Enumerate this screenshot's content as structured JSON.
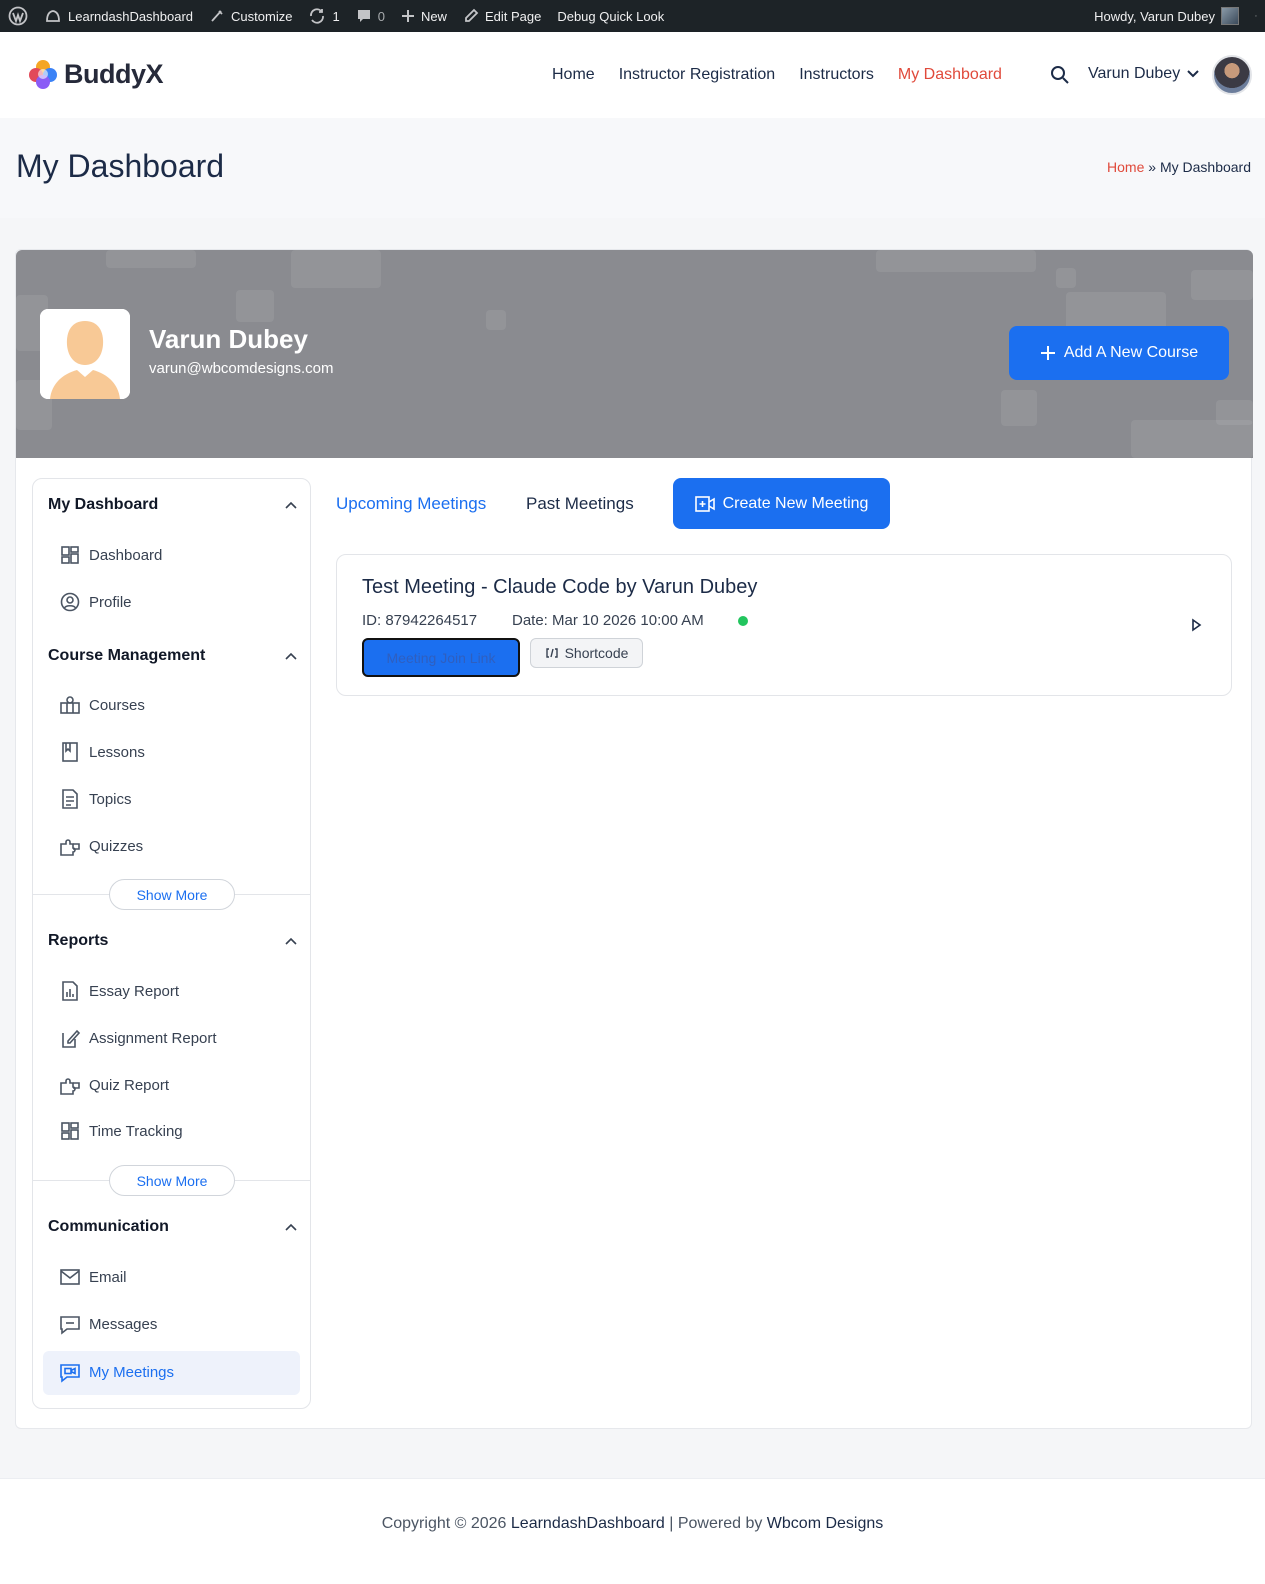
{
  "admin_bar": {
    "site_name": "LearndashDashboard",
    "customize": "Customize",
    "updates_count": "1",
    "comments_count": "0",
    "new_label": "New",
    "edit_page": "Edit Page",
    "debug": "Debug Quick Look",
    "howdy": "Howdy, Varun Dubey"
  },
  "header": {
    "logo_text": "BuddyX",
    "nav": [
      {
        "label": "Home"
      },
      {
        "label": "Instructor Registration"
      },
      {
        "label": "Instructors"
      },
      {
        "label": "My Dashboard",
        "active": true
      }
    ],
    "user_name": "Varun Dubey"
  },
  "page": {
    "title": "My Dashboard",
    "breadcrumb_home": "Home",
    "breadcrumb_sep": "»",
    "breadcrumb_current": "My Dashboard"
  },
  "profile": {
    "name": "Varun Dubey",
    "email": "varun@wbcomdesigns.com",
    "add_course_label": "Add A New Course"
  },
  "sidebar": {
    "sections": [
      {
        "title": "My Dashboard",
        "items": [
          {
            "label": "Dashboard",
            "icon": "dashboard-icon"
          },
          {
            "label": "Profile",
            "icon": "profile-icon"
          }
        ]
      },
      {
        "title": "Course Management",
        "items": [
          {
            "label": "Courses",
            "icon": "courses-icon"
          },
          {
            "label": "Lessons",
            "icon": "lessons-icon"
          },
          {
            "label": "Topics",
            "icon": "topics-icon"
          },
          {
            "label": "Quizzes",
            "icon": "quizzes-icon"
          }
        ],
        "show_more": "Show More"
      },
      {
        "title": "Reports",
        "items": [
          {
            "label": "Essay Report",
            "icon": "essay-report-icon"
          },
          {
            "label": "Assignment Report",
            "icon": "assignment-report-icon"
          },
          {
            "label": "Quiz Report",
            "icon": "quiz-report-icon"
          },
          {
            "label": "Time Tracking",
            "icon": "time-tracking-icon"
          }
        ],
        "show_more": "Show More"
      },
      {
        "title": "Communication",
        "items": [
          {
            "label": "Email",
            "icon": "email-icon"
          },
          {
            "label": "Messages",
            "icon": "messages-icon"
          },
          {
            "label": "My Meetings",
            "icon": "meetings-icon",
            "active": true
          }
        ]
      }
    ]
  },
  "meetings": {
    "tab_upcoming": "Upcoming Meetings",
    "tab_past": "Past Meetings",
    "create_label": "Create New Meeting",
    "items": [
      {
        "title": "Test Meeting - Claude Code by Varun Dubey",
        "id_text": "ID: 87942264517",
        "date_text": "Date: Mar 10 2026 10:00 AM",
        "status_color": "#22c55e",
        "join_label": "Meeting Join Link",
        "shortcode_label": "Shortcode"
      }
    ]
  },
  "footer": {
    "prefix": "Copyright © 2026",
    "site": "LearndashDashboard",
    "middle": "| Powered by",
    "powered_by": "Wbcom Designs"
  },
  "colors": {
    "accent": "#1b6ff0",
    "active_nav": "#e04a3b"
  }
}
